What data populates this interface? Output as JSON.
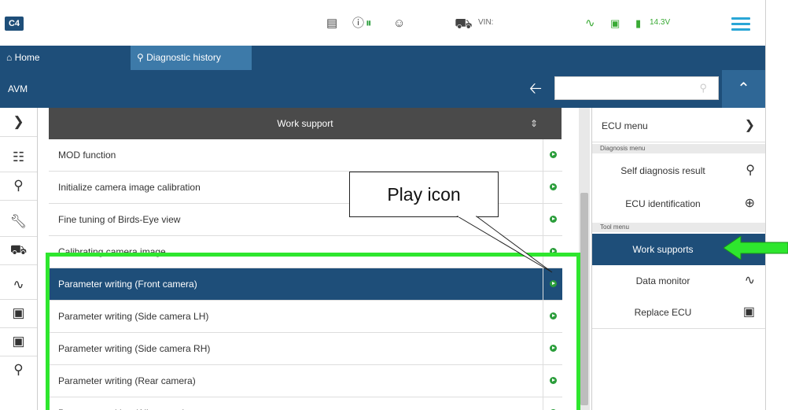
{
  "topbar": {
    "logo": "C4",
    "vin_label": "VIN:",
    "voltage": "14.3V"
  },
  "tabs": [
    {
      "label": "Home"
    },
    {
      "label": "Diagnostic history"
    }
  ],
  "breadcrumb": {
    "label": "AVM",
    "search_placeholder": ""
  },
  "list": {
    "title": "Work support",
    "rows": [
      {
        "label": "MOD function"
      },
      {
        "label": "Initialize camera image calibration"
      },
      {
        "label": "Fine tuning of Birds-Eye view"
      },
      {
        "label": "Calibrating camera image"
      },
      {
        "label": "Parameter writing (Front camera)",
        "selected": true
      },
      {
        "label": "Parameter writing (Side camera LH)"
      },
      {
        "label": "Parameter writing (Side camera RH)"
      },
      {
        "label": "Parameter writing (Rear camera)"
      },
      {
        "label": "Parameter writing (All camera)"
      }
    ]
  },
  "right_panel": {
    "ecu_menu": "ECU menu",
    "diagnosis_menu": "Diagnosis menu",
    "self_diagnosis": "Self diagnosis result",
    "ecu_identification": "ECU identification",
    "tool_menu": "Tool menu",
    "work_supports": "Work supports",
    "data_monitor": "Data monitor",
    "replace_ecu": "Replace ECU"
  },
  "annotation": {
    "callout_text": "Play icon",
    "highlight_color": "#2ee62e"
  },
  "colors": {
    "primary": "#1e4e79",
    "play_green": "#2a9d3a",
    "tab_active": "#3d7aa9"
  }
}
